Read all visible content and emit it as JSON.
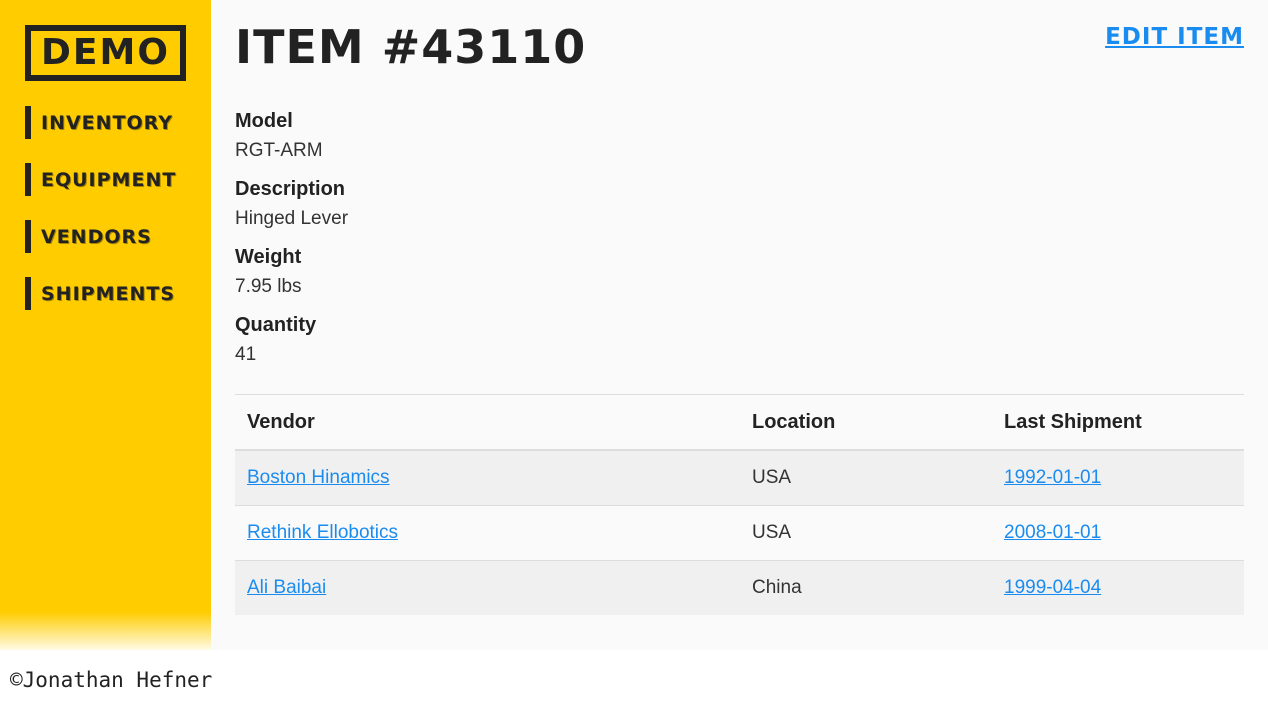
{
  "sidebar": {
    "logo": "DEMO",
    "items": [
      {
        "label": "Inventory"
      },
      {
        "label": "Equipment"
      },
      {
        "label": "Vendors"
      },
      {
        "label": "Shipments"
      }
    ]
  },
  "header": {
    "title": "Item #43110",
    "edit_label": "Edit Item"
  },
  "details": {
    "model_label": "Model",
    "model_value": "RGT-ARM",
    "description_label": "Description",
    "description_value": "Hinged Lever",
    "weight_label": "Weight",
    "weight_value": "7.95 lbs",
    "quantity_label": "Quantity",
    "quantity_value": "41"
  },
  "table": {
    "headers": [
      "Vendor",
      "Location",
      "Last Shipment"
    ],
    "rows": [
      {
        "vendor": "Boston Hinamics",
        "location": "USA",
        "last_shipment": "1992-01-01"
      },
      {
        "vendor": "Rethink Ellobotics",
        "location": "USA",
        "last_shipment": "2008-01-01"
      },
      {
        "vendor": "Ali Baibai",
        "location": "China",
        "last_shipment": "1999-04-04"
      }
    ]
  },
  "footer": {
    "copyright": "©Jonathan Hefner"
  },
  "colors": {
    "sidebar_bg": "#ffcc00",
    "link": "#1a8cf0",
    "text": "#222222",
    "row_stripe": "#f0f0f0"
  }
}
